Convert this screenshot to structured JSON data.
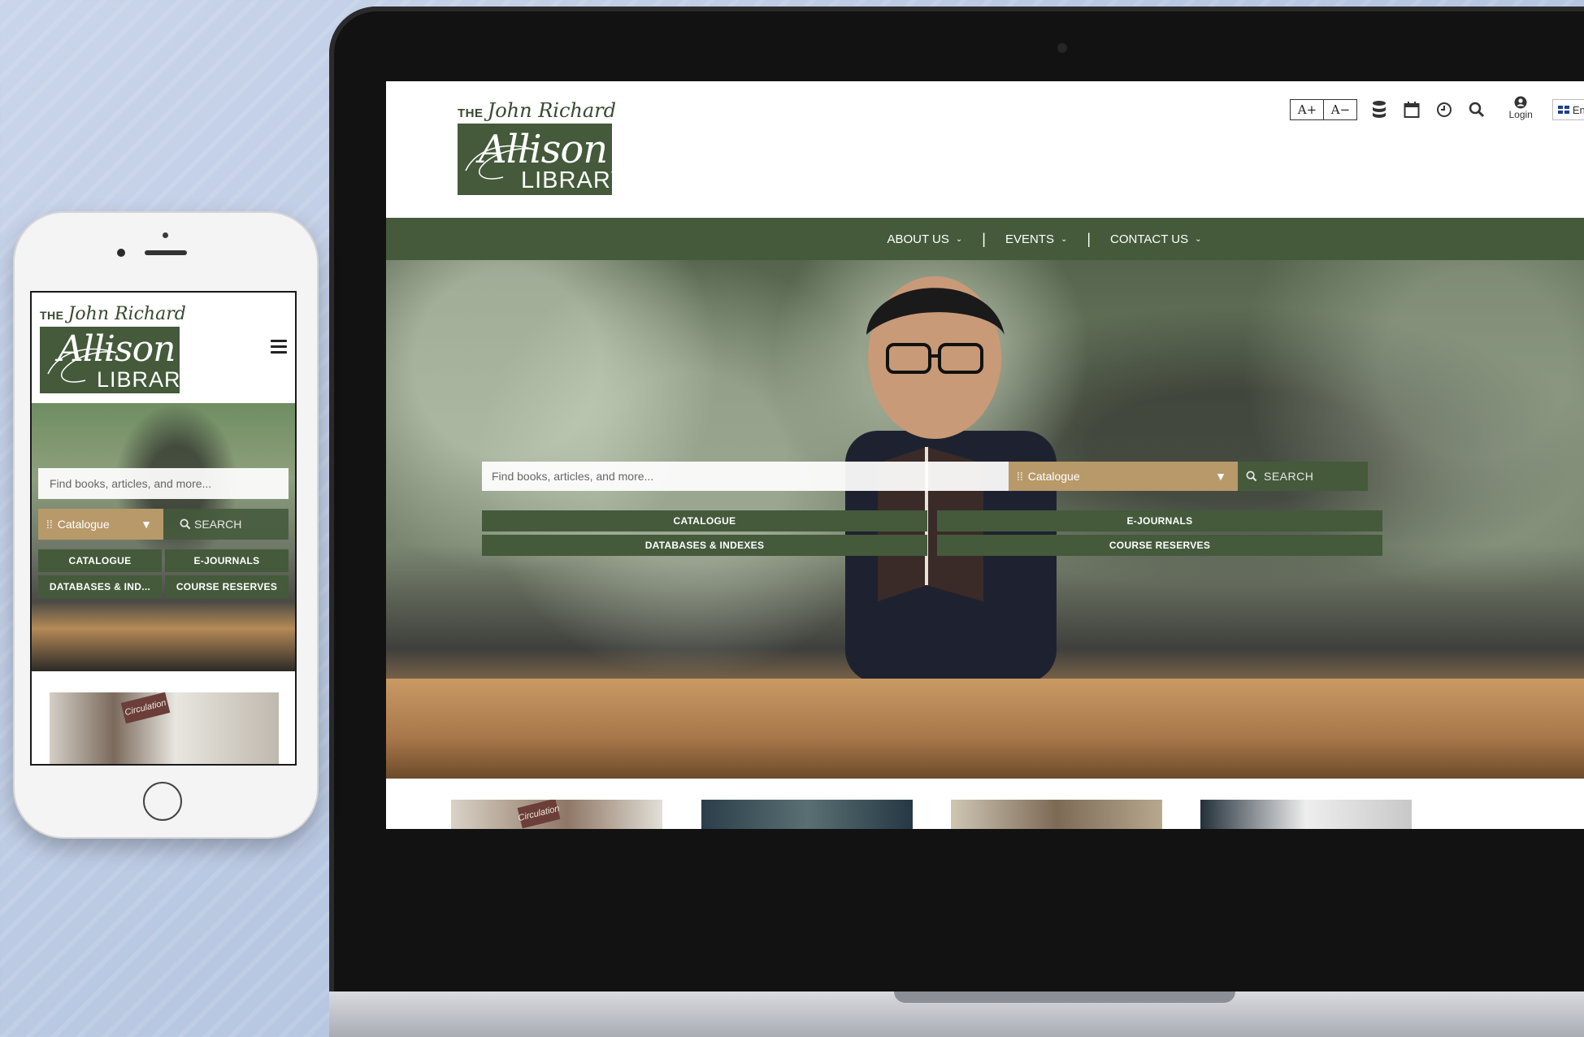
{
  "brand": {
    "logo_the": "THE",
    "logo_name": "John Richard",
    "logo_allison": "Allison",
    "logo_library": "LIBRARY",
    "colors": {
      "primary_green": "#445a3b",
      "accent_tan": "#b8996a"
    }
  },
  "header_tools": {
    "font_increase": "A+",
    "font_decrease": "A−",
    "icons": [
      "database-icon",
      "calendar-icon",
      "clock-icon",
      "search-icon",
      "user-icon"
    ],
    "login_label": "Login",
    "language_label": "Eng"
  },
  "nav": {
    "items": [
      {
        "label": "ABOUT US"
      },
      {
        "label": "EVENTS"
      },
      {
        "label": "CONTACT US"
      }
    ],
    "separator": "|"
  },
  "hero": {
    "search_placeholder": "Find books, articles, and more...",
    "scope_value": "Catalogue",
    "search_button": "SEARCH",
    "quick_links": [
      {
        "label": "CATALOGUE"
      },
      {
        "label": "E-JOURNALS"
      },
      {
        "label": "DATABASES & INDEXES"
      },
      {
        "label": "COURSE RESERVES"
      }
    ]
  },
  "mobile": {
    "search_placeholder": "Find books, articles, and more...",
    "scope_value": "Catalogue",
    "search_button": "SEARCH",
    "quick_links": [
      {
        "label": "CATALOGUE"
      },
      {
        "label": "E-JOURNALS"
      },
      {
        "label": "DATABASES & IND..."
      },
      {
        "label": "COURSE RESERVES"
      }
    ]
  },
  "thumbs": {
    "sign_text": "Circulation"
  }
}
